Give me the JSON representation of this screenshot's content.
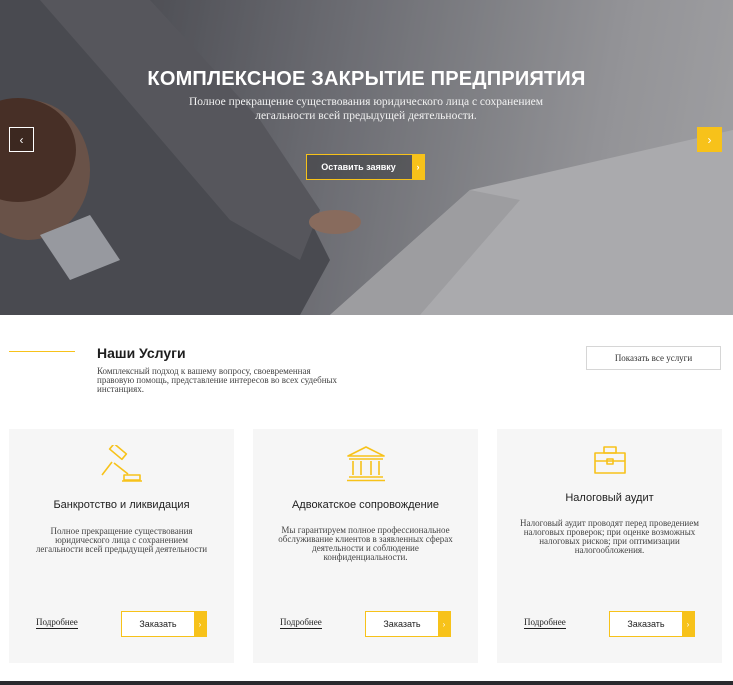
{
  "hero": {
    "title": "КОМПЛЕКСНОЕ ЗАКРЫТИЕ ПРЕДПРИЯТИЯ",
    "subtitle": "Полное прекращение существования юридического лица с сохранением легальности всей предыдущей деятельности.",
    "cta_label": "Оставить заявку",
    "prev_arrow": "‹",
    "next_arrow": "›"
  },
  "services": {
    "title": "Наши Услуги",
    "description": "Комплексный подход к вашему вопросу, своевременная правовую помощь, представление интересов во всех судебных инстанциях.",
    "show_all_label": "Показать все услуги",
    "cards": [
      {
        "icon": "gavel-icon",
        "title": "Банкротство и ликвидация",
        "description": "Полное прекращение существования юридического лица с сохранением легальности всей предыдущей деятельности",
        "more_label": "Подробнее",
        "order_label": "Заказать"
      },
      {
        "icon": "courthouse-icon",
        "title": "Адвокатское сопровождение",
        "description": "Мы гарантируем полное профессиональное обслуживание клиентов в заявленных сферах деятельности и соблюдение конфиденциальности.",
        "more_label": "Подробнее",
        "order_label": "Заказать"
      },
      {
        "icon": "briefcase-icon",
        "title": "Налоговый аудит",
        "description": "Налоговый аудит проводят перед проведением налоговых проверок; при оценке возможных налоговых рисков; при оптимизации налогообложения.",
        "more_label": "Подробнее",
        "order_label": "Заказать"
      }
    ]
  },
  "colors": {
    "accent": "#f7c21a",
    "card_bg": "#f6f6f6"
  }
}
